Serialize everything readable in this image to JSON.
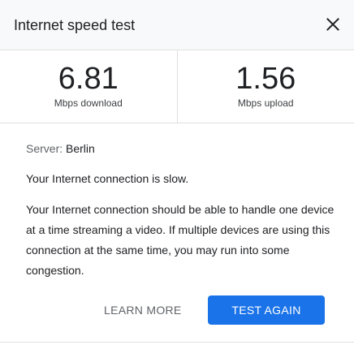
{
  "dialog": {
    "title": "Internet speed test",
    "close_icon": "close-icon"
  },
  "metrics": {
    "download": {
      "value": "6.81",
      "label": "Mbps download"
    },
    "upload": {
      "value": "1.56",
      "label": "Mbps upload"
    }
  },
  "details": {
    "server_label": "Server:",
    "server_value": "Berlin",
    "status": "Your Internet connection is slow.",
    "description": "Your Internet connection should be able to handle one device at a time streaming a video. If multiple devices are using this connection at the same time, you may run into some congestion."
  },
  "actions": {
    "learn_more": "LEARN MORE",
    "test_again": "TEST AGAIN"
  },
  "colors": {
    "accent": "#1a73e8",
    "header_bg": "#f8f9fa",
    "divider": "#e0e0e0"
  }
}
